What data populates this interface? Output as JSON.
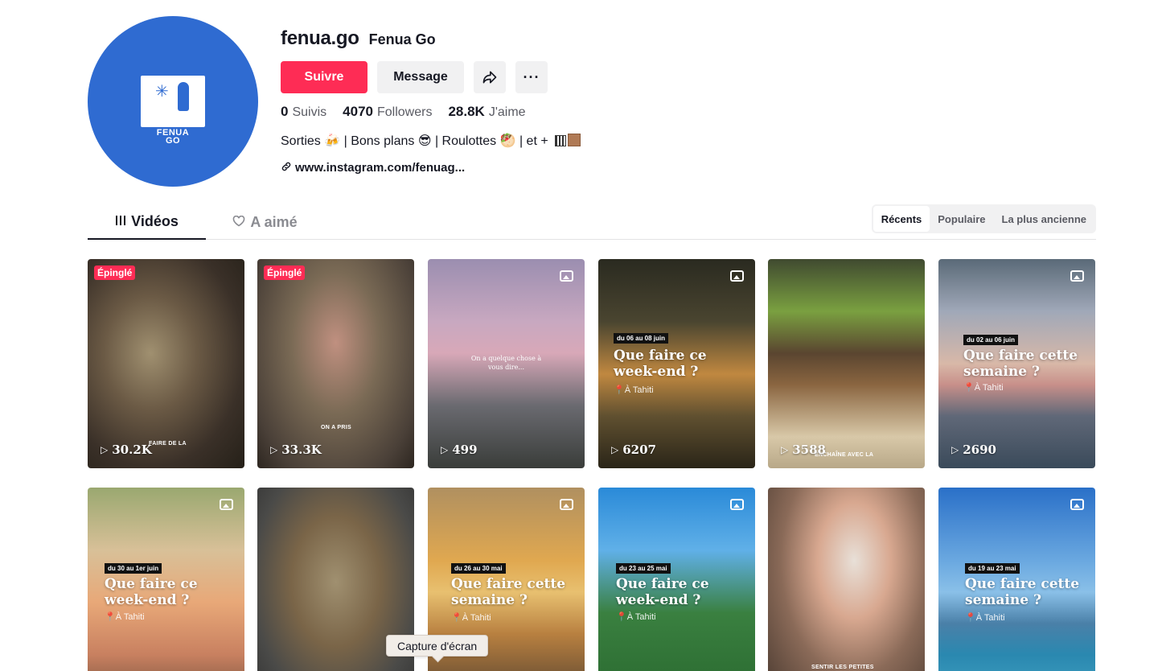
{
  "profile": {
    "username": "fenua.go",
    "nickname": "Fenua Go",
    "logo_text_1": "FENUA",
    "logo_text_2": "GO",
    "follow_label": "Suivre",
    "message_label": "Message",
    "share_icon": "share-icon",
    "more_icon": "more-icon",
    "stats": {
      "following_count": "0",
      "following_label": "Suivis",
      "followers_count": "4070",
      "followers_label": "Followers",
      "likes_count": "28.8K",
      "likes_label": "J'aime"
    },
    "bio": "Sorties 🍻 | Bons plans 😎 | Roulottes 🥙 | et + ",
    "link": "www.instagram.com/fenuag..."
  },
  "tabs": {
    "videos_label": "Vidéos",
    "liked_label": "A aimé"
  },
  "sort": {
    "recent": "Récents",
    "popular": "Populaire",
    "oldest": "La plus ancienne"
  },
  "videos": [
    {
      "views": "30.2K",
      "pinned": "Épinglé",
      "caption": "FAIRE DE LA"
    },
    {
      "views": "33.3K",
      "pinned": "Épinglé",
      "caption": "ON A PRIS"
    },
    {
      "views": "499",
      "overlay": "On a quelque chose à vous dire..."
    },
    {
      "views": "6207",
      "date": "du 06 au 08 juin",
      "headline": "Que faire ce week-end ?",
      "location": "📍À Tahiti"
    },
    {
      "views": "3588",
      "caption": "ENCHAÎNE AVEC LA"
    },
    {
      "views": "2690",
      "date": "du 02 au 06 juin",
      "headline": "Que faire cette semaine ?",
      "location": "📍À Tahiti"
    },
    {
      "date": "du 30 au 1er juin",
      "headline": "Que faire ce week-end ?",
      "location": "📍À Tahiti"
    },
    {},
    {
      "date": "du 26 au 30 mai",
      "headline": "Que faire cette semaine ?",
      "location": "📍À Tahiti"
    },
    {
      "date": "du 23 au 25 mai",
      "headline": "Que faire ce week-end ?",
      "location": "📍À Tahiti"
    },
    {
      "caption": "SENTIR LES PETITES"
    },
    {
      "date": "du 19 au 23 mai",
      "headline": "Que faire cette semaine ?",
      "location": "📍À Tahiti"
    }
  ],
  "tooltip": "Capture d'écran"
}
